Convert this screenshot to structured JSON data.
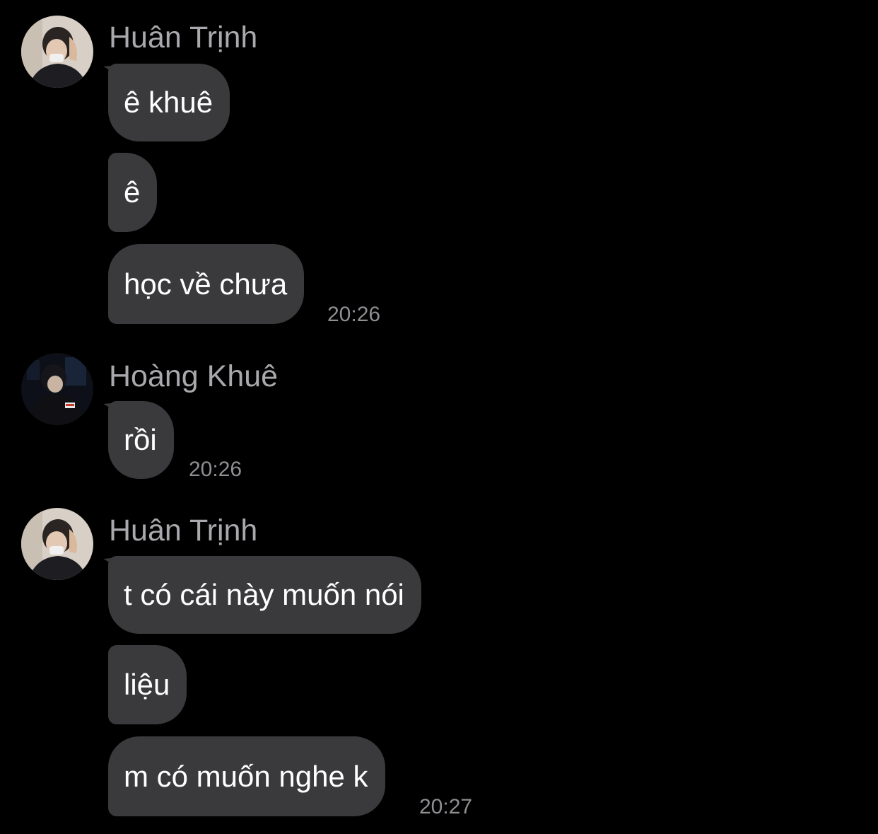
{
  "messages": [
    {
      "sender": "Huân Trịnh",
      "avatar_icon": "avatar-huan-trinh",
      "bubbles": [
        "ê khuê",
        "ê",
        "học về chưa"
      ],
      "time": "20:26"
    },
    {
      "sender": "Hoàng Khuê",
      "avatar_icon": "avatar-hoang-khue",
      "bubbles": [
        "rồi"
      ],
      "time": "20:26"
    },
    {
      "sender": "Huân Trịnh",
      "avatar_icon": "avatar-huan-trinh",
      "bubbles": [
        "t có cái này muốn nói",
        "liệu",
        "m có muốn nghe k"
      ],
      "time": "20:27"
    }
  ],
  "colors": {
    "background": "#000000",
    "bubble": "#3a3a3c",
    "bubble_text": "#ffffff",
    "sender_name": "#a9a9ad",
    "timestamp": "#8e8e93"
  }
}
